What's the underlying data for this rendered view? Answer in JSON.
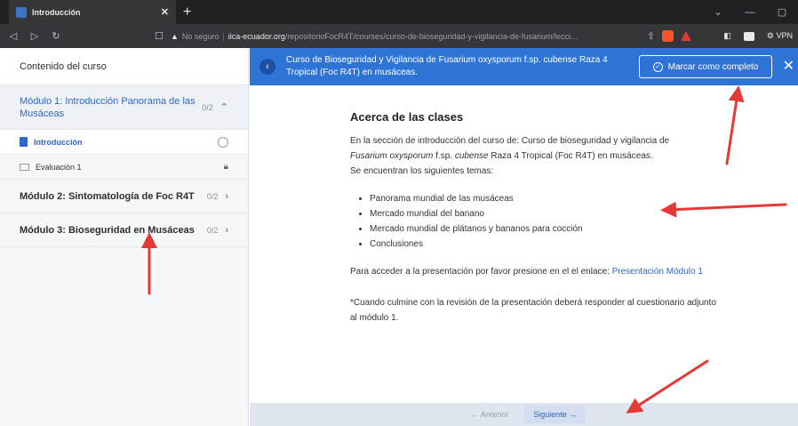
{
  "browser": {
    "tab_title": "Introducción",
    "tab_close": "✕",
    "new_tab": "+",
    "url_warning": "No seguro",
    "url_domain": "iica-ecuador.org",
    "url_path": "/repositorioFocR4T/courses/curso-de-bioseguridad-y-vigilancia-de-fusarium/lecci...",
    "vpn_label": "VPN"
  },
  "sidebar": {
    "header": "Contenido del curso",
    "modules": [
      {
        "title": "Módulo 1: Introducción Panorama de las Musáceas",
        "progress": "0/2",
        "lessons": [
          {
            "label": "Introducción"
          },
          {
            "label": "Evaluación 1"
          }
        ]
      },
      {
        "title": "Módulo 2: Sintomatología de Foc R4T",
        "progress": "0/2"
      },
      {
        "title": "Módulo 3: Bioseguridad en Musáceas",
        "progress": "0/2"
      }
    ]
  },
  "course_bar": {
    "title": "Curso de Bioseguridad y Vigilancia de Fusarium oxysporum f.sp. cubense Raza 4 Tropical (Foc R4T) en musáceas.",
    "complete_button": "Marcar como completo"
  },
  "content": {
    "heading": "Acerca de las clases",
    "intro_1": "En la sección de introducción del curso de: Curso de bioseguridad y vigilancia de",
    "intro_italic_1": "Fusarium oxysporum",
    "intro_2": " f.sp. ",
    "intro_italic_2": "cubense",
    "intro_3": " Raza 4 Tropical (Foc R4T) en musáceas.",
    "intro_4": "Se encuentran los siguientes temas:",
    "topics": [
      "Panorama mundial de las musáceas",
      "Mercado mundial del banano",
      "Mercado mundial de plátanos y bananos para cocción",
      "Conclusiones"
    ],
    "access_text": "Para acceder a la presentación por favor presione en el el enlace: ",
    "link_text": "Presentación Módulo 1",
    "note": "*Cuando culmine con la revisión de la presentación deberá responder al cuestionario adjunto al módulo 1."
  },
  "footer": {
    "prev": "← Anterior",
    "next": "Siguiente →"
  },
  "colors": {
    "accent": "#2e74d6",
    "annotation": "#e53935"
  }
}
